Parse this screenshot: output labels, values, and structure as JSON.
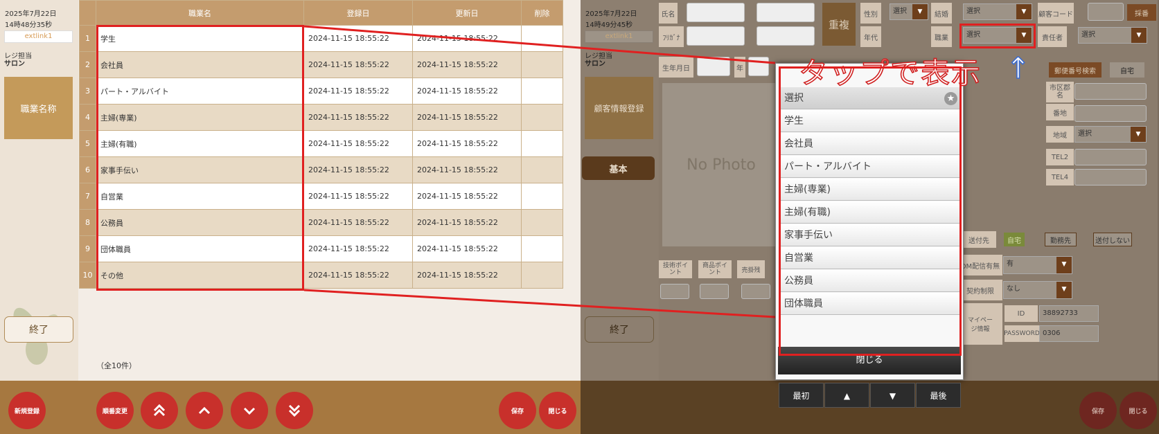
{
  "left": {
    "date": "2025年7月22日",
    "time": "14時48分35秒",
    "store_link": "extlink1",
    "staff_label": "レジ担当",
    "staff_name": "サロン",
    "section_title": "職業名称",
    "end_button": "終了",
    "table": {
      "headers": [
        "職業名",
        "登録日",
        "更新日",
        "削除"
      ],
      "rows": [
        {
          "no": "1",
          "name": "学生",
          "created": "2024-11-15 18:55:22",
          "updated": "2024-11-15 18:55:22"
        },
        {
          "no": "2",
          "name": "会社員",
          "created": "2024-11-15 18:55:22",
          "updated": "2024-11-15 18:55:22"
        },
        {
          "no": "3",
          "name": "パート・アルバイト",
          "created": "2024-11-15 18:55:22",
          "updated": "2024-11-15 18:55:22"
        },
        {
          "no": "4",
          "name": "主婦(専業)",
          "created": "2024-11-15 18:55:22",
          "updated": "2024-11-15 18:55:22"
        },
        {
          "no": "5",
          "name": "主婦(有職)",
          "created": "2024-11-15 18:55:22",
          "updated": "2024-11-15 18:55:22"
        },
        {
          "no": "6",
          "name": "家事手伝い",
          "created": "2024-11-15 18:55:22",
          "updated": "2024-11-15 18:55:22"
        },
        {
          "no": "7",
          "name": "自営業",
          "created": "2024-11-15 18:55:22",
          "updated": "2024-11-15 18:55:22"
        },
        {
          "no": "8",
          "name": "公務員",
          "created": "2024-11-15 18:55:22",
          "updated": "2024-11-15 18:55:22"
        },
        {
          "no": "9",
          "name": "団体職員",
          "created": "2024-11-15 18:55:22",
          "updated": "2024-11-15 18:55:22"
        },
        {
          "no": "10",
          "name": "その他",
          "created": "2024-11-15 18:55:22",
          "updated": "2024-11-15 18:55:22"
        }
      ]
    },
    "total": "（全10件）",
    "footer": {
      "new": "新規登録",
      "reorder": "順番変更",
      "first_icon": "double-chevron-up-icon",
      "up_icon": "chevron-up-icon",
      "down_icon": "chevron-down-icon",
      "last_icon": "double-chevron-down-icon",
      "save": "保存",
      "close": "閉じる"
    }
  },
  "right": {
    "date": "2025年7月22日",
    "time": "14時49分45秒",
    "store_link": "extlink1",
    "staff_label": "レジ担当",
    "staff_name": "サロン",
    "section_title": "顧客情報登録",
    "tab_basic": "基本",
    "end_button": "終了",
    "no_photo": "No Photo",
    "fields": {
      "name": "氏名",
      "kana": "ﾌﾘｶﾞﾅ",
      "duplicate": "重複",
      "gender": "性別",
      "gender_value": "選択",
      "marriage": "結婚",
      "marriage_value": "選択",
      "customer_code": "顧客コード",
      "assign_button": "採番",
      "age": "年代",
      "job": "職業",
      "job_value": "選択",
      "manager": "責任者",
      "manager_value": "選択",
      "birthday": "生年月日",
      "year": "年",
      "zip_search": "郵便番号検索",
      "home": "自宅",
      "city": "市区郡名",
      "address_no": "番地",
      "region": "地域",
      "region_value": "選択",
      "tel2": "TEL2",
      "tel4": "TEL4",
      "send_to": "送付先",
      "send_home": "自宅",
      "send_work": "勤務先",
      "send_none": "送付しない",
      "delivery": "DM配信有無",
      "delivery_value": "有",
      "contract": "契約制限",
      "contract_value": "なし",
      "tech_point": "技術ポイント",
      "product_point": "商品ポイント",
      "sales": "売掛残",
      "page_info": "マイページ情報",
      "id_label": "ID",
      "id_value": "38892733",
      "password_label": "PASSWORD",
      "password_value": "0306"
    },
    "footer": {
      "save": "保存",
      "close": "閉じる"
    },
    "popup": {
      "items": [
        "選択",
        "学生",
        "会社員",
        "パート・アルバイト",
        "主婦(専業)",
        "主婦(有職)",
        "家事手伝い",
        "自営業",
        "公務員",
        "団体職員"
      ],
      "first": "最初",
      "up": "▲",
      "down": "▼",
      "last": "最後",
      "close": "閉じる"
    },
    "annotation": "タップで表示",
    "annotation_arrow": "↑"
  },
  "colors": {
    "highlight": "#e02020",
    "accent": "#c49a5a",
    "footer": "#a67840",
    "round_button": "#c8302b"
  }
}
